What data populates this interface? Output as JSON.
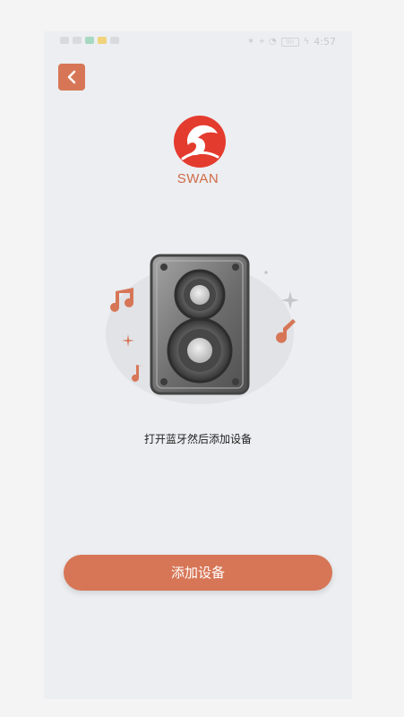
{
  "status_bar": {
    "time": "4:57",
    "battery": "90"
  },
  "header": {
    "back_label": "",
    "brand_name": "SWAN"
  },
  "main": {
    "instruction": "打开蓝牙然后添加设备",
    "add_button": "添加设备"
  },
  "colors": {
    "accent": "#d77657",
    "logo_red": "#e43b2f",
    "background": "#eceef1"
  },
  "icons": {
    "back": "chevron-left-icon",
    "logo": "swan-logo",
    "speaker": "speaker-illustration",
    "music_note": "music-note-icon",
    "sparkle": "sparkle-icon"
  }
}
